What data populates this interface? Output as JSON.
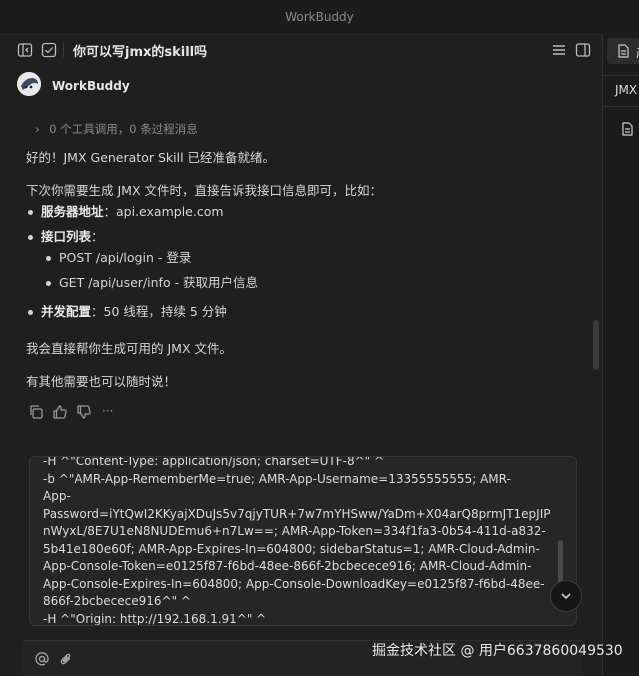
{
  "window": {
    "title": "WorkBuddy"
  },
  "header": {
    "chat_title": "你可以写jmx的skill吗"
  },
  "right_panel": {
    "tab_label": "产",
    "file_label": "JMX"
  },
  "agent": {
    "name": "WorkBuddy"
  },
  "tool_summary": "0 个工具调用，0 条过程消息",
  "message": {
    "intro": "好的！JMX Generator Skill 已经准备就绪。",
    "next_time": "下次你需要生成 JMX 文件时，直接告诉我接口信息即可，比如：",
    "server_label": "服务器地址",
    "server_value": "：api.example.com",
    "api_list_label": "接口列表",
    "api_list_colon": "：",
    "apis": [
      "POST /api/login - 登录",
      "GET /api/user/info - 获取用户信息"
    ],
    "concurrency_label": "并发配置",
    "concurrency_value": "：50 线程，持续 5 分钟",
    "direct_help": "我会直接帮你生成可用的 JMX 文件。",
    "anytime": "有其他需要也可以随时说！"
  },
  "actions": [
    "copy-icon",
    "thumbs-up-icon",
    "thumbs-down-icon",
    "more-icon"
  ],
  "more_label": "···",
  "code_lines": [
    "  -H ^\"Content-Type: application/json; charset=UTF-8^\" ^",
    "  -b ^\"AMR-App-RememberMe=true; AMR-App-Username=13355555555; AMR-",
    "App-",
    "Password=iYtQwI2KKyajXDuJs5v7qjyTUR+7w7mYHSww/YaDm+X04arQ8prmJT1epJIP",
    "nWyxL/8E7U1eN8NUDEmu6+n7Lw==; AMR-App-Token=334f1fa3-0b54-411d-a832-",
    "5b41e180e60f; AMR-App-Expires-In=604800; sidebarStatus=1; AMR-Cloud-Admin-",
    "App-Console-Token=e0125f87-f6bd-48ee-866f-2bcbecece916; AMR-Cloud-Admin-",
    "App-Console-Expires-In=604800; App-Console-DownloadKey=e0125f87-f6bd-48ee-",
    "866f-2bcbecece916^\" ^",
    "  -H ^\"Origin: http://192.168.1.91^\" ^"
  ],
  "watermark": "掘金技术社区 @ 用户6637860049530",
  "colors": {
    "background": "#1f1f1f",
    "text": "#d6d6d6",
    "muted": "#8a8a8a",
    "code_bg": "#262626"
  }
}
